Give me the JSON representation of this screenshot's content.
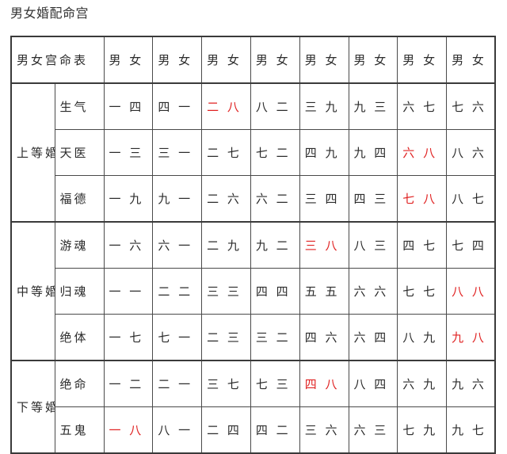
{
  "page": {
    "title": "男女婚配命宫"
  },
  "table": {
    "header": {
      "corner_label": "男女宫命表",
      "pair_labels": [
        "男 女",
        "男 女",
        "男 女",
        "男 女",
        "男 女",
        "男 女",
        "男 女",
        "男 女"
      ]
    },
    "highlight_color": "#e02222",
    "groups": [
      {
        "label": "上等婚",
        "rows": [
          {
            "name": "生气",
            "cells": [
              {
                "text": "一 四",
                "highlight": false
              },
              {
                "text": "四 一",
                "highlight": false
              },
              {
                "text": "二 八",
                "highlight": true
              },
              {
                "text": "八 二",
                "highlight": false
              },
              {
                "text": "三 九",
                "highlight": false
              },
              {
                "text": "九 三",
                "highlight": false
              },
              {
                "text": "六 七",
                "highlight": false
              },
              {
                "text": "七 六",
                "highlight": false
              }
            ]
          },
          {
            "name": "天医",
            "cells": [
              {
                "text": "一 三",
                "highlight": false
              },
              {
                "text": "三 一",
                "highlight": false
              },
              {
                "text": "二 七",
                "highlight": false
              },
              {
                "text": "七 二",
                "highlight": false
              },
              {
                "text": "四 九",
                "highlight": false
              },
              {
                "text": "九 四",
                "highlight": false
              },
              {
                "text": "六 八",
                "highlight": true
              },
              {
                "text": "八 六",
                "highlight": false
              }
            ]
          },
          {
            "name": "福德",
            "cells": [
              {
                "text": "一 九",
                "highlight": false
              },
              {
                "text": "九 一",
                "highlight": false
              },
              {
                "text": "二 六",
                "highlight": false
              },
              {
                "text": "六 二",
                "highlight": false
              },
              {
                "text": "三 四",
                "highlight": false
              },
              {
                "text": "四 三",
                "highlight": false
              },
              {
                "text": "七 八",
                "highlight": true
              },
              {
                "text": "八 七",
                "highlight": false
              }
            ]
          }
        ]
      },
      {
        "label": "中等婚",
        "rows": [
          {
            "name": "游魂",
            "cells": [
              {
                "text": "一 六",
                "highlight": false
              },
              {
                "text": "六 一",
                "highlight": false
              },
              {
                "text": "二 九",
                "highlight": false
              },
              {
                "text": "九 二",
                "highlight": false
              },
              {
                "text": "三 八",
                "highlight": true
              },
              {
                "text": "八 三",
                "highlight": false
              },
              {
                "text": "四 七",
                "highlight": false
              },
              {
                "text": "七 四",
                "highlight": false
              }
            ]
          },
          {
            "name": "归魂",
            "cells": [
              {
                "text": "一 一",
                "highlight": false
              },
              {
                "text": "二 二",
                "highlight": false
              },
              {
                "text": "三 三",
                "highlight": false
              },
              {
                "text": "四 四",
                "highlight": false
              },
              {
                "text": "五 五",
                "highlight": false
              },
              {
                "text": "六 六",
                "highlight": false
              },
              {
                "text": "七 七",
                "highlight": false
              },
              {
                "text": "八 八",
                "highlight": true
              }
            ]
          },
          {
            "name": "绝体",
            "cells": [
              {
                "text": "一 七",
                "highlight": false
              },
              {
                "text": "七 一",
                "highlight": false
              },
              {
                "text": "二 三",
                "highlight": false
              },
              {
                "text": "三 二",
                "highlight": false
              },
              {
                "text": "四 六",
                "highlight": false
              },
              {
                "text": "六 四",
                "highlight": false
              },
              {
                "text": "八 九",
                "highlight": false
              },
              {
                "text": "九 八",
                "highlight": true
              }
            ]
          }
        ]
      },
      {
        "label": "下等婚",
        "rows": [
          {
            "name": "绝命",
            "cells": [
              {
                "text": "一 二",
                "highlight": false
              },
              {
                "text": "二 一",
                "highlight": false
              },
              {
                "text": "三 七",
                "highlight": false
              },
              {
                "text": "七 三",
                "highlight": false
              },
              {
                "text": "四 八",
                "highlight": true
              },
              {
                "text": "八 四",
                "highlight": false
              },
              {
                "text": "六 九",
                "highlight": false
              },
              {
                "text": "九 六",
                "highlight": false
              }
            ]
          },
          {
            "name": "五鬼",
            "cells": [
              {
                "text": "一 八",
                "highlight": true
              },
              {
                "text": "八 一",
                "highlight": false
              },
              {
                "text": "二 四",
                "highlight": false
              },
              {
                "text": "四 二",
                "highlight": false
              },
              {
                "text": "三 六",
                "highlight": false
              },
              {
                "text": "六 三",
                "highlight": false
              },
              {
                "text": "七 九",
                "highlight": false
              },
              {
                "text": "九 七",
                "highlight": false
              }
            ]
          }
        ]
      }
    ]
  }
}
